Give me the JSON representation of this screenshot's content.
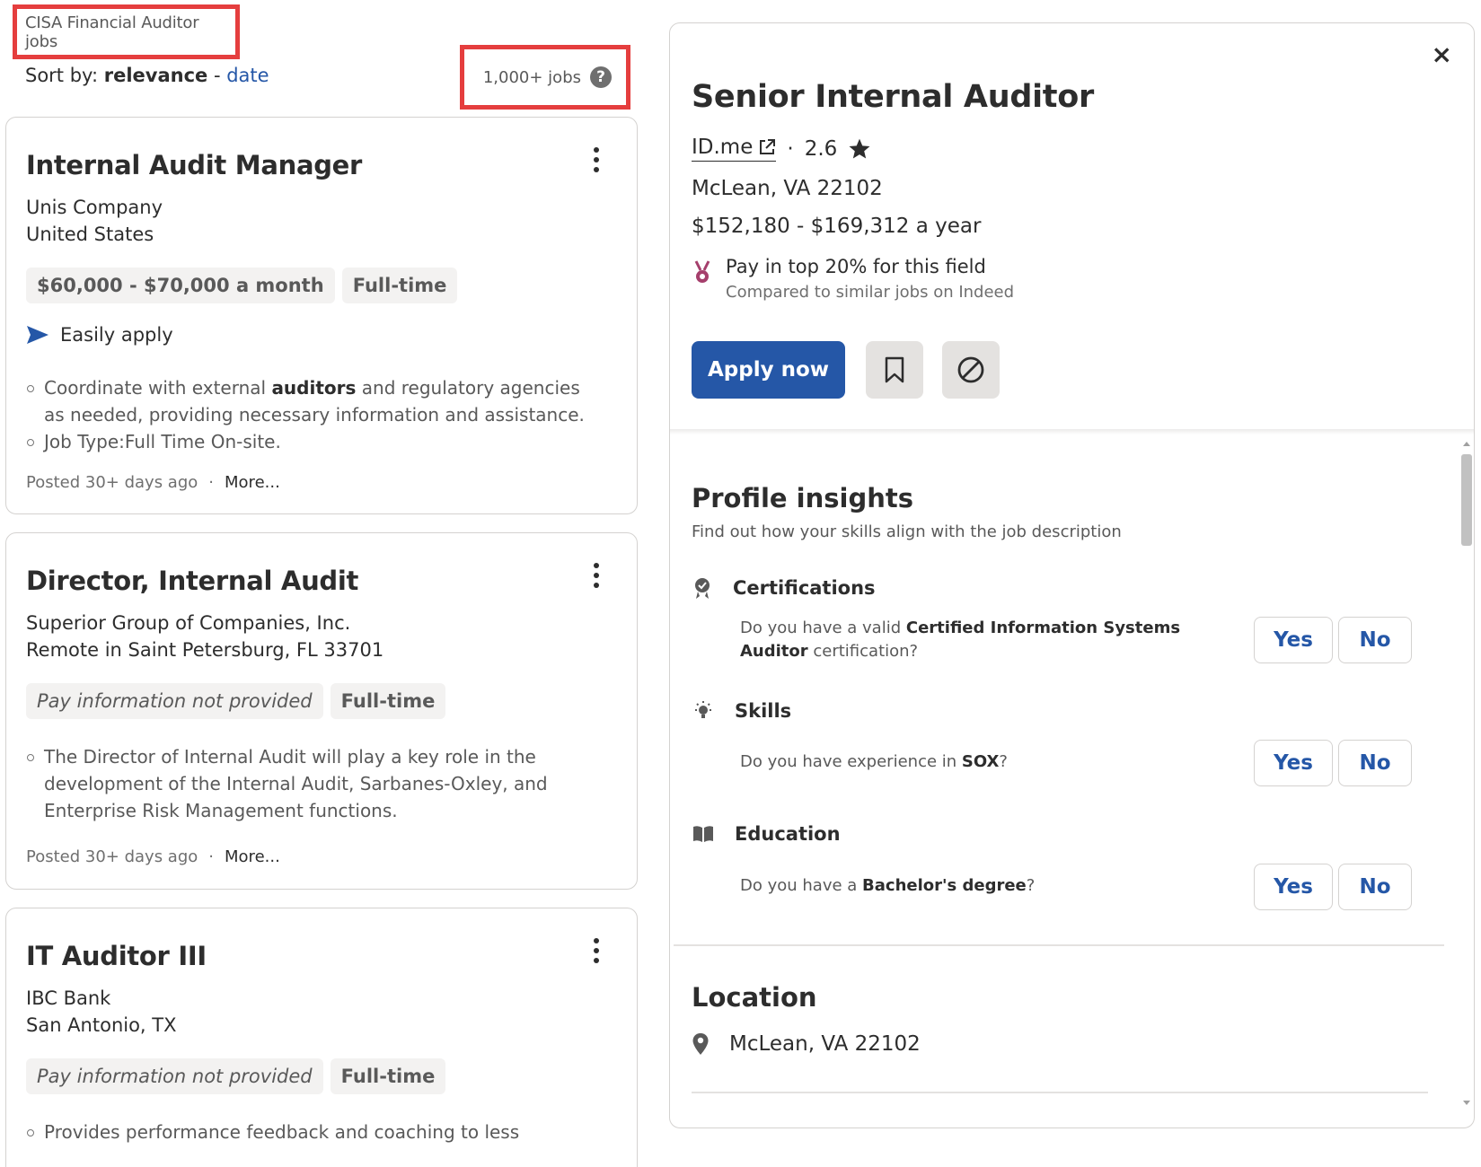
{
  "search": {
    "query_label": "CISA Financial Auditor jobs",
    "sort_prefix": "Sort by:",
    "sort_active": "relevance",
    "sort_sep": "-",
    "sort_alt": "date",
    "jobs_count": "1,000+ jobs",
    "help_glyph": "?"
  },
  "jobs": [
    {
      "title": "Internal Audit Manager",
      "company": "Unis Company",
      "location": "United States",
      "salary": "$60,000 - $70,000 a month",
      "type": "Full-time",
      "easy_apply": "Easily apply",
      "bullet1_a": "Coordinate with external ",
      "bullet1_b": "auditors",
      "bullet1_c": " and regulatory agencies as needed, providing necessary information and assistance.",
      "bullet2": "Job Type:Full Time On-site.",
      "posted": "Posted 30+ days ago",
      "dot": "·",
      "more": "More..."
    },
    {
      "title": "Director, Internal Audit",
      "company": "Superior Group of Companies, Inc.",
      "location": "Remote in Saint Petersburg, FL 33701",
      "salary": "Pay information not provided",
      "type": "Full-time",
      "bullet1": "The Director of Internal Audit will play a key role in the development of the Internal Audit, Sarbanes-Oxley, and Enterprise Risk Management functions.",
      "posted": "Posted 30+ days ago",
      "dot": "·",
      "more": "More..."
    },
    {
      "title": "IT Auditor III",
      "company": "IBC Bank",
      "location": "San Antonio, TX",
      "salary": "Pay information not provided",
      "type": "Full-time",
      "bullet1": "Provides performance feedback and coaching to less"
    }
  ],
  "detail": {
    "close_glyph": "×",
    "title": "Senior Internal Auditor",
    "company": "ID.me",
    "separator": "·",
    "rating": "2.6",
    "location": "McLean, VA 22102",
    "salary": "$152,180 - $169,312 a year",
    "top_pay": "Pay in top 20% for this field",
    "top_pay_sub": "Compared to similar jobs on Indeed",
    "apply": "Apply now",
    "insights_title": "Profile insights",
    "insights_sub": "Find out how your skills align with the job description",
    "cert_head": "Certifications",
    "cert_q_a": "Do you have a valid ",
    "cert_q_b": "Certified Information Systems Auditor",
    "cert_q_c": " certification?",
    "skills_head": "Skills",
    "skills_q_a": "Do you have experience in ",
    "skills_q_b": "SOX",
    "skills_q_c": "?",
    "edu_head": "Education",
    "edu_q_a": "Do you have a ",
    "edu_q_b": "Bachelor's degree",
    "edu_q_c": "?",
    "yes": "Yes",
    "no": "No",
    "location_title": "Location",
    "location_value": "McLean, VA 22102"
  },
  "colors": {
    "accent": "#2557a7",
    "highlight_border": "#e53e3e",
    "chip_bg": "#f3f2f1",
    "badge": "#a53f6c"
  }
}
